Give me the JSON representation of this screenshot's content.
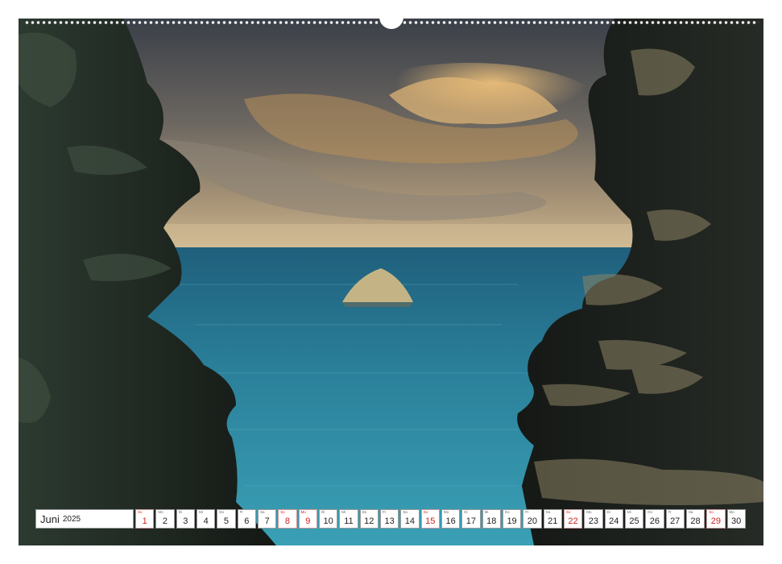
{
  "calendar": {
    "month": "Juni",
    "year": "2025",
    "days": [
      {
        "wd": "So",
        "num": "1",
        "sunday": true
      },
      {
        "wd": "Mo",
        "num": "2",
        "sunday": false
      },
      {
        "wd": "Di",
        "num": "3",
        "sunday": false
      },
      {
        "wd": "Mi",
        "num": "4",
        "sunday": false
      },
      {
        "wd": "Do",
        "num": "5",
        "sunday": false
      },
      {
        "wd": "Fr",
        "num": "6",
        "sunday": false
      },
      {
        "wd": "Sa",
        "num": "7",
        "sunday": false
      },
      {
        "wd": "So",
        "num": "8",
        "sunday": true
      },
      {
        "wd": "Mo",
        "num": "9",
        "sunday": true
      },
      {
        "wd": "Di",
        "num": "10",
        "sunday": false
      },
      {
        "wd": "Mi",
        "num": "11",
        "sunday": false
      },
      {
        "wd": "Do",
        "num": "12",
        "sunday": false
      },
      {
        "wd": "Fr",
        "num": "13",
        "sunday": false
      },
      {
        "wd": "Sa",
        "num": "14",
        "sunday": false
      },
      {
        "wd": "So",
        "num": "15",
        "sunday": true
      },
      {
        "wd": "Mo",
        "num": "16",
        "sunday": false
      },
      {
        "wd": "Di",
        "num": "17",
        "sunday": false
      },
      {
        "wd": "Mi",
        "num": "18",
        "sunday": false
      },
      {
        "wd": "Do",
        "num": "19",
        "sunday": false
      },
      {
        "wd": "Fr",
        "num": "20",
        "sunday": false
      },
      {
        "wd": "Sa",
        "num": "21",
        "sunday": false
      },
      {
        "wd": "So",
        "num": "22",
        "sunday": true
      },
      {
        "wd": "Mo",
        "num": "23",
        "sunday": false
      },
      {
        "wd": "Di",
        "num": "24",
        "sunday": false
      },
      {
        "wd": "Mi",
        "num": "25",
        "sunday": false
      },
      {
        "wd": "Do",
        "num": "26",
        "sunday": false
      },
      {
        "wd": "Fr",
        "num": "27",
        "sunday": false
      },
      {
        "wd": "Sa",
        "num": "28",
        "sunday": false
      },
      {
        "wd": "So",
        "num": "29",
        "sunday": true
      },
      {
        "wd": "Mo",
        "num": "30",
        "sunday": false
      }
    ]
  },
  "colors": {
    "sunday": "#d42020",
    "sea": "#2b7b95",
    "sky_warm": "#d9a55a",
    "rock_dark": "#1c211d"
  }
}
